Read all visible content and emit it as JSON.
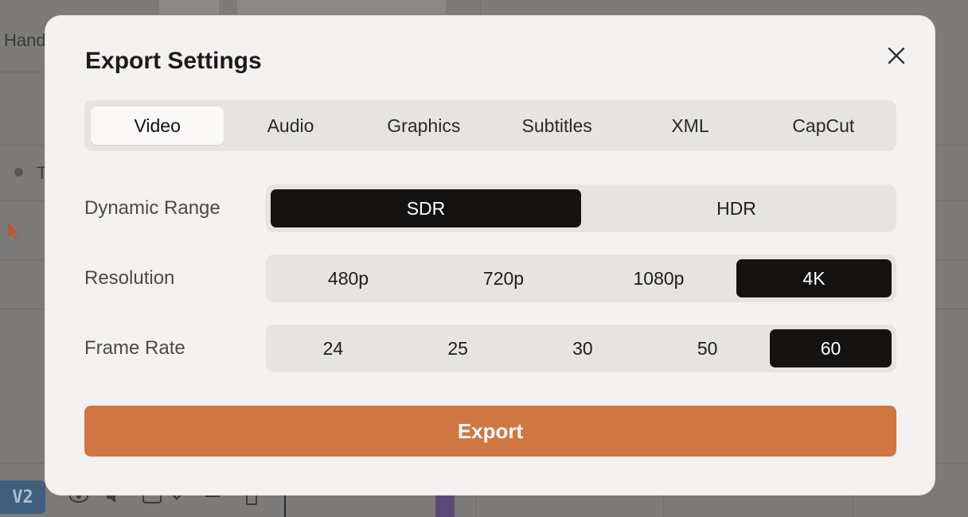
{
  "background": {
    "partial_label": "Hand",
    "partial_label_2": "T",
    "track_badge": "V2"
  },
  "modal": {
    "title": "Export Settings",
    "close_icon": "close-icon",
    "tabs": [
      "Video",
      "Audio",
      "Graphics",
      "Subtitles",
      "XML",
      "CapCut"
    ],
    "active_tab": "Video",
    "dynamic_range": {
      "label": "Dynamic Range",
      "options": [
        "SDR",
        "HDR"
      ],
      "selected": "SDR"
    },
    "resolution": {
      "label": "Resolution",
      "options": [
        "480p",
        "720p",
        "1080p",
        "4K"
      ],
      "selected": "4K"
    },
    "frame_rate": {
      "label": "Frame Rate",
      "options": [
        "24",
        "25",
        "30",
        "50",
        "60"
      ],
      "selected": "60"
    },
    "export_label": "Export"
  },
  "colors": {
    "accent": "#d07643",
    "selected_segment": "#141311",
    "modal_bg": "#f4f2f0",
    "overlay": "#7c7b79",
    "track_badge": "#3f5f7e"
  }
}
